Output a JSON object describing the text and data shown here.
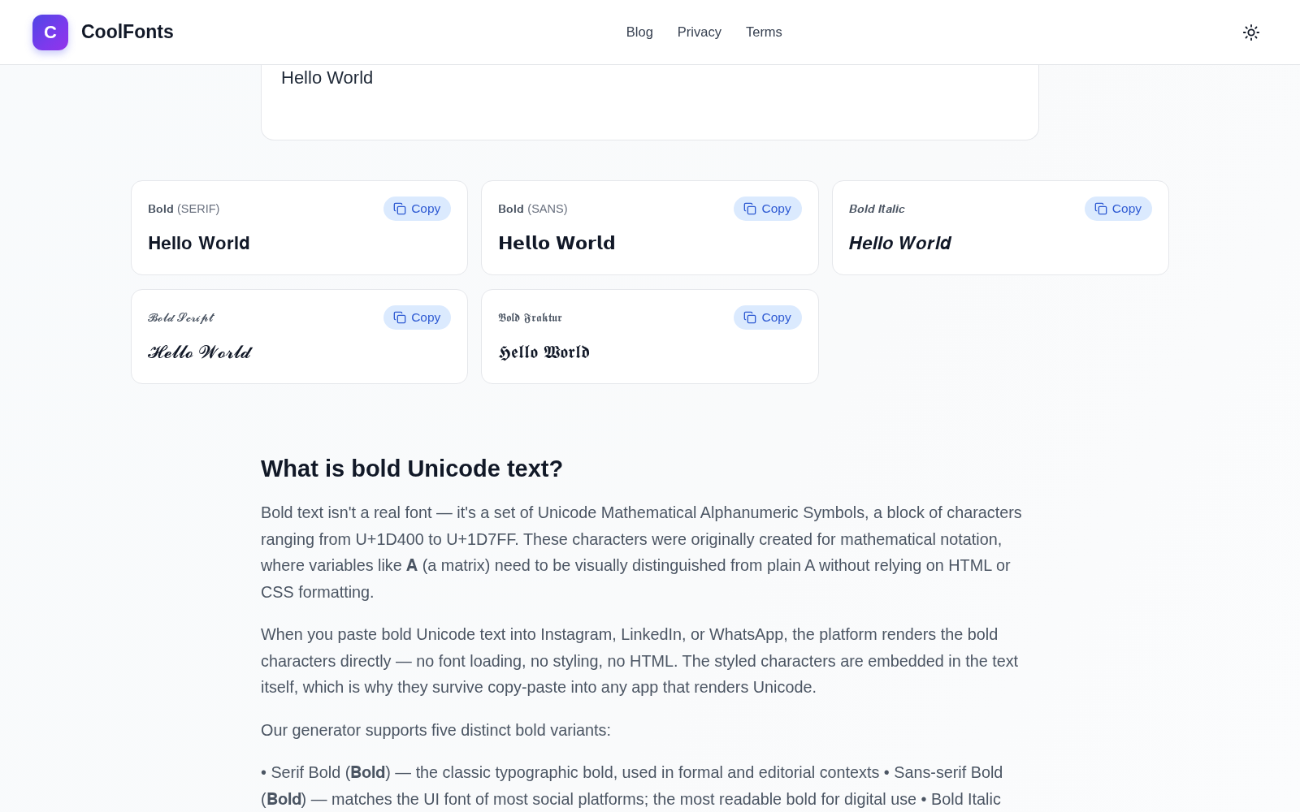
{
  "header": {
    "logo_letter": "C",
    "brand": "CoolFonts",
    "nav": [
      "Blog",
      "Privacy",
      "Terms"
    ]
  },
  "input": {
    "value": "Hello World"
  },
  "variants": [
    {
      "name": "𝐁𝐨𝐥𝐝",
      "tag": "(SERIF)",
      "button": "Copy",
      "preview": "𝐇𝐞𝐥𝐥𝐨 𝐖𝐨𝐫𝐥𝐝"
    },
    {
      "name": "𝐁𝐨𝐥𝐝",
      "tag": "(SANS)",
      "button": "Copy",
      "preview": "𝗛𝗲𝗹𝗹𝗼 𝗪𝗼𝗿𝗹𝗱"
    },
    {
      "name": "𝑩𝒐𝒍𝒅 𝑰𝒕𝒂𝒍𝒊𝒄",
      "button": "Copy",
      "preview": "𝑯𝒆𝒍𝒍𝒐 𝑾𝒐𝒓𝒍𝒅"
    },
    {
      "name": "𝓑𝓸𝓵𝓭 𝓢𝓬𝓻𝓲𝓹𝓽",
      "button": "Copy",
      "preview": "𝓗𝓮𝓵𝓵𝓸 𝓦𝓸𝓻𝓵𝓭"
    },
    {
      "name": "𝕭𝖔𝖑𝖉 𝕱𝖗𝖆𝖐𝖙𝖚𝖗",
      "button": "Copy",
      "preview": "𝕳𝖊𝖑𝖑𝖔 𝖂𝖔𝖗𝖑𝖉"
    }
  ],
  "article": {
    "heading": "What is bold Unicode text?",
    "paragraphs": [
      "Bold text isn't a real font — it's a set of Unicode Mathematical Alphanumeric Symbols, a block of characters ranging from U+1D400 to U+1D7FF. These characters were originally created for mathematical notation, where variables like 𝐀 (a matrix) need to be visually distinguished from plain A without relying on HTML or CSS formatting.",
      "When you paste bold Unicode text into Instagram, LinkedIn, or WhatsApp, the platform renders the bold characters directly — no font loading, no styling, no HTML. The styled characters are embedded in the text itself, which is why they survive copy-paste into any app that renders Unicode.",
      "Our generator supports five distinct bold variants:",
      "• Serif Bold (𝐁𝐨𝐥𝐝) — the classic typographic bold, used in formal and editorial contexts • Sans-serif Bold (𝐁𝐨𝐥𝐝) — matches the UI font of most social platforms; the most readable bold for digital use • Bold Italic"
    ]
  }
}
